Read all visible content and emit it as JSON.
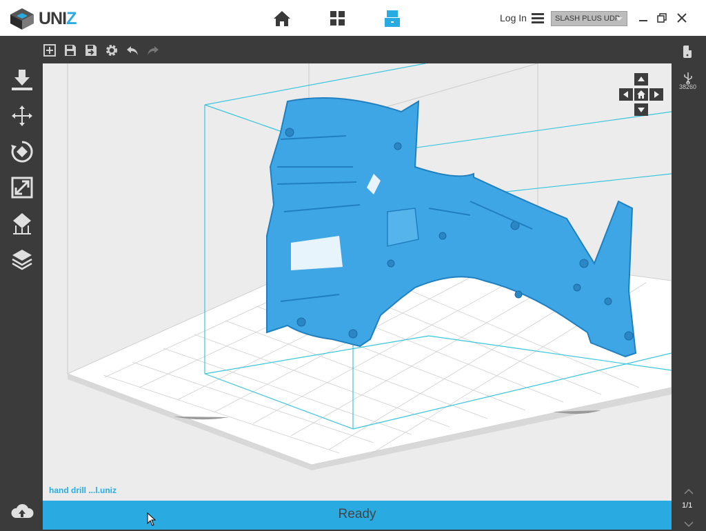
{
  "app": {
    "logo_text_1": "UNI",
    "logo_text_2": "Z"
  },
  "titlebar": {
    "nav": [
      {
        "name": "home-icon"
      },
      {
        "name": "grid-icon"
      },
      {
        "name": "printer-icon"
      }
    ],
    "login_label": "Log In",
    "printer_selected": "SLASH PLUS UDP"
  },
  "colors": {
    "accent": "#29abe2",
    "dark_panel": "#3b3b3b",
    "viewport_bg": "#ececec",
    "model": "#3fa6e6"
  },
  "toolbar": {
    "icons": [
      "add-file-icon",
      "save-icon",
      "save-as-icon",
      "settings-icon",
      "undo-icon",
      "redo-icon"
    ]
  },
  "leftbar": {
    "icons": [
      "download-icon",
      "move-icon",
      "rotate-icon",
      "scale-icon",
      "support-icon",
      "layers-icon"
    ]
  },
  "rightbar": {
    "usb_count": "38260",
    "page": "1/1"
  },
  "viewport": {
    "file_name": "hand drill ...l.uniz"
  },
  "status": {
    "text": "Ready"
  }
}
